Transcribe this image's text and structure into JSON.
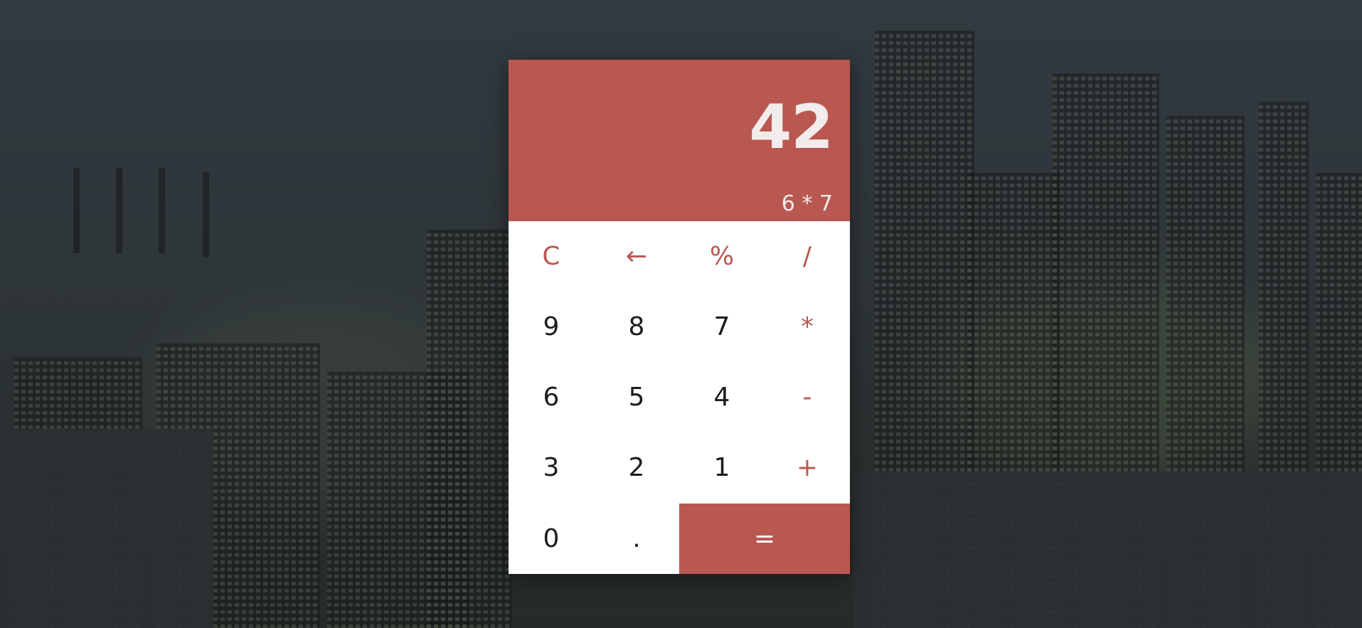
{
  "display": {
    "result": "42",
    "expression": "6 * 7"
  },
  "keys": {
    "clear": "C",
    "backspace": "←",
    "percent": "%",
    "divide": "/",
    "nine": "9",
    "eight": "8",
    "seven": "7",
    "multiply": "*",
    "six": "6",
    "five": "5",
    "four": "4",
    "subtract": "-",
    "three": "3",
    "two": "2",
    "one": "1",
    "add": "+",
    "zero": "0",
    "decimal": ".",
    "equals": "="
  },
  "colors": {
    "accent": "#b95850",
    "background": "#2f353a",
    "digit_text": "#1c1c1c",
    "display_text": "#f3ecec"
  }
}
